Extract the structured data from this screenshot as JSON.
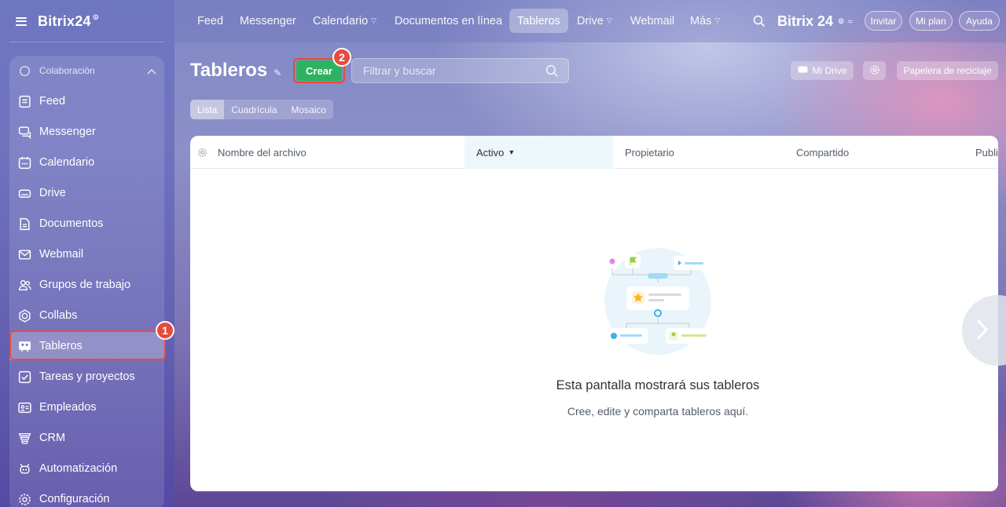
{
  "brand": {
    "name": "Bitrix24",
    "mark": "⊙"
  },
  "sidebar": {
    "section": "Colaboración",
    "items": [
      {
        "label": "Feed",
        "icon": "feed-icon"
      },
      {
        "label": "Messenger",
        "icon": "chat-icon"
      },
      {
        "label": "Calendario",
        "icon": "calendar-icon"
      },
      {
        "label": "Drive",
        "icon": "drive-icon"
      },
      {
        "label": "Documentos",
        "icon": "document-icon"
      },
      {
        "label": "Webmail",
        "icon": "mail-icon"
      },
      {
        "label": "Grupos de trabajo",
        "icon": "group-icon"
      },
      {
        "label": "Collabs",
        "icon": "collab-icon"
      },
      {
        "label": "Tableros",
        "icon": "board-icon",
        "active": true
      },
      {
        "label": "Tareas y proyectos",
        "icon": "task-icon"
      },
      {
        "label": "Empleados",
        "icon": "employee-icon"
      },
      {
        "label": "CRM",
        "icon": "crm-icon"
      },
      {
        "label": "Automatización",
        "icon": "automation-icon"
      },
      {
        "label": "Configuración",
        "icon": "settings-icon"
      }
    ]
  },
  "topnav": {
    "items": [
      "Feed",
      "Messenger",
      "Calendario",
      "Documentos en línea",
      "Tableros",
      "Drive",
      "Webmail",
      "Más"
    ],
    "brand": "Bitrix 24",
    "invite": "Invitar",
    "plan": "Mi plan",
    "help": "Ayuda"
  },
  "page": {
    "title": "Tableros",
    "create": "Crear",
    "search_placeholder": "Filtrar y buscar",
    "my_drive": "Mi Drive",
    "trash": "Papelera de reciclaje",
    "views": [
      "Lista",
      "Cuadrícula",
      "Mosaico"
    ]
  },
  "table": {
    "columns": [
      "Nombre del archivo",
      "Activo",
      "Propietario",
      "Compartido",
      "Publi"
    ]
  },
  "empty": {
    "title": "Esta pantalla mostrará sus tableros",
    "subtitle": "Cree, edite y comparta tableros aquí."
  },
  "annotations": [
    "1",
    "2"
  ],
  "colors": {
    "accent_green": "#2fb25f",
    "highlight_red": "#e74b3c"
  }
}
